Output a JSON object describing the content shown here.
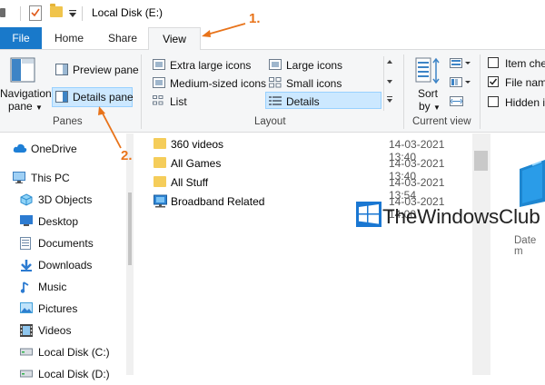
{
  "window": {
    "title": "Local Disk (E:)"
  },
  "tabs": {
    "file": "File",
    "home": "Home",
    "share": "Share",
    "view": "View"
  },
  "ribbon": {
    "panes": {
      "navigation_pane_line1": "Navigation",
      "navigation_pane_line2": "pane",
      "preview_pane": "Preview pane",
      "details_pane": "Details pane",
      "group_label": "Panes"
    },
    "layout": {
      "extra_large_icons": "Extra large icons",
      "large_icons": "Large icons",
      "medium_sized_icons": "Medium-sized icons",
      "small_icons": "Small icons",
      "list": "List",
      "details": "Details",
      "group_label": "Layout"
    },
    "current_view": {
      "sort_by_line1": "Sort",
      "sort_by_line2": "by",
      "group_label": "Current view"
    },
    "show_hide": {
      "item_check_boxes": "Item che",
      "file_name_extensions": "File nam",
      "hidden_items": "Hidden i",
      "item_check_boxes_checked": false,
      "file_name_extensions_checked": true,
      "hidden_items_checked": false
    }
  },
  "nav": {
    "items": [
      {
        "label": "OneDrive",
        "icon": "cloud-icon"
      },
      {
        "label": "This PC",
        "icon": "computer-icon"
      },
      {
        "label": "3D Objects",
        "icon": "cube-icon"
      },
      {
        "label": "Desktop",
        "icon": "desktop-icon"
      },
      {
        "label": "Documents",
        "icon": "documents-icon"
      },
      {
        "label": "Downloads",
        "icon": "download-icon"
      },
      {
        "label": "Music",
        "icon": "music-icon"
      },
      {
        "label": "Pictures",
        "icon": "pictures-icon"
      },
      {
        "label": "Videos",
        "icon": "videos-icon"
      },
      {
        "label": "Local Disk (C:)",
        "icon": "drive-icon"
      },
      {
        "label": "Local Disk (D:)",
        "icon": "drive-icon"
      }
    ]
  },
  "files": [
    {
      "name": "360 videos",
      "date": "14-03-2021 13:40",
      "icon": "folder-icon"
    },
    {
      "name": "All Games",
      "date": "14-03-2021 13:40",
      "icon": "folder-icon"
    },
    {
      "name": "All Stuff",
      "date": "14-03-2021 13:54",
      "icon": "folder-icon"
    },
    {
      "name": "Broadband Related",
      "date": "14-03-2021 14:00",
      "icon": "network-folder-icon"
    }
  ],
  "details_pane": {
    "date_label": "Date m"
  },
  "watermark": {
    "text": "TheWindowsClub"
  },
  "annotations": {
    "step1": "1.",
    "step2": "2."
  },
  "colors": {
    "accent": "#1979ca",
    "selection": "#cce8ff",
    "annotation": "#e8731a"
  }
}
